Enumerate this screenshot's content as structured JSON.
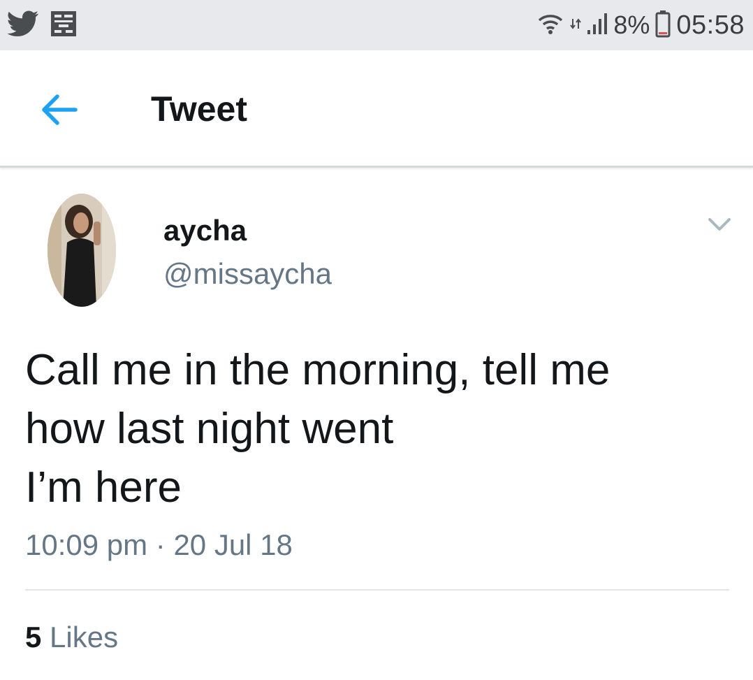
{
  "status_bar": {
    "battery_percent": "8%",
    "time": "05:58",
    "icons": [
      "twitter-bird-icon",
      "notification-app-icon",
      "wifi-icon",
      "data-arrows-icon",
      "signal-icon",
      "battery-icon"
    ]
  },
  "header": {
    "title": "Tweet",
    "back_icon": "back-arrow-icon"
  },
  "tweet": {
    "display_name": "aycha",
    "handle": "@missaycha",
    "text_lines": [
      "Call me in the morning, tell me",
      "how last night went",
      "I’m here"
    ],
    "timestamp": "10:09 pm · 20 Jul 18",
    "likes_count": "5",
    "likes_label": "Likes",
    "menu_icon": "chevron-down-icon"
  },
  "colors": {
    "accent": "#1da1f2",
    "status_bar_bg": "#e7e9ec",
    "secondary_text": "#657786",
    "primary_text": "#14171a"
  }
}
